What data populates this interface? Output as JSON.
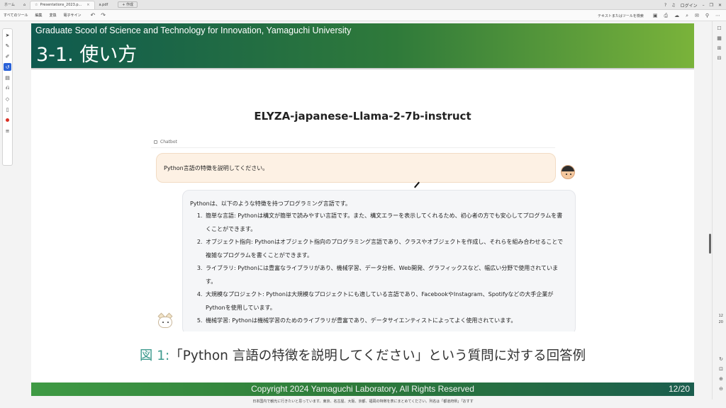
{
  "tabs": {
    "home_label": "ホーム",
    "tab1": "Presentations_2023.p...",
    "tab2": "a.pdf",
    "new_tab": "+ 作成"
  },
  "titlebar": {
    "login_label": "ログイン"
  },
  "menu": {
    "items": [
      "すべてのツール",
      "編集",
      "変換",
      "電子サイン"
    ],
    "search_placeholder": "テキストまたはツールを検索"
  },
  "slide": {
    "header_sub": "Graduate Scool of Science and Technology for Innovation, Yamaguchi University",
    "header_title": "3-1. 使い方",
    "model_title": "ELYZA-japanese-Llama-2-7b-instruct",
    "chatbot_label": "Chatbot",
    "user_message": "Python言語の特徴を説明してください。",
    "bot_intro": "Pythonは、以下のような特徴を持つプログラミング言語です。",
    "bot_items": [
      "簡単な言語: Pythonは構文が簡単で読みやすい言語です。また、構文エラーを表示してくれるため、初心者の方でも安心してプログラムを書くことができます。",
      "オブジェクト指向: Pythonはオブジェクト指向のプログラミング言語であり、クラスやオブジェクトを作成し、それらを組み合わせることで複雑なプログラムを書くことができます。",
      "ライブラリ: Pythonには豊富なライブラリがあり、機械学習、データ分析、Web開発、グラフィックスなど、幅広い分野で使用されています。",
      "大規模なプロジェクト: Pythonは大規模なプロジェクトにも適している言語であり、FacebookやInstagram、Spotifyなどの大手企業がPythonを使用しています。",
      "機械学習: Pythonは機械学習のためのライブラリが豊富であり、データサイエンティストによってよく使用されています。"
    ],
    "caption_fig": "図 1:",
    "caption_text": "「Python 言語の特徴を説明してください」という質問に対する回答例",
    "footer": "Copyright 2024 Yamaguchi Laboratory, All Rights Reserved",
    "page": "12/20"
  },
  "viewer": {
    "current_page": "12",
    "total_pages": "20"
  },
  "subtitle": "日本国内で観光に行きたいと思っています。東京、名古屋、大阪、京都、福岡の特徴を表にまとめてください。列名は「都道府県」「おすす"
}
